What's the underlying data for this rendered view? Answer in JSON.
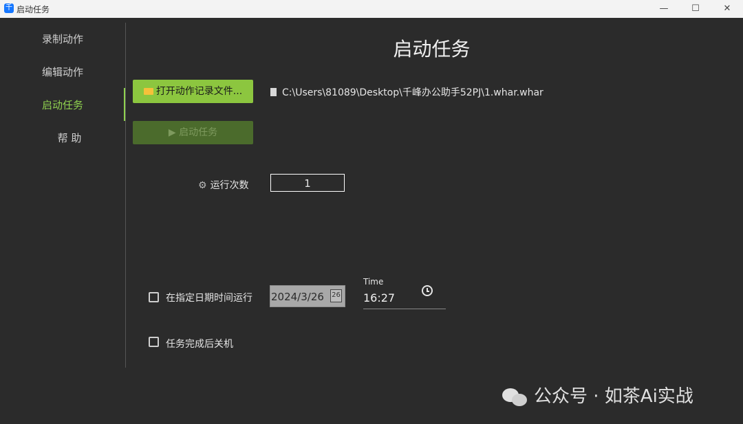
{
  "window": {
    "title": "启动任务",
    "icon": "app-logo-icon"
  },
  "window_controls": {
    "minimize": "—",
    "maximize": "☐",
    "close": "✕"
  },
  "sidebar": {
    "items": [
      {
        "label": "录制动作",
        "active": false
      },
      {
        "label": "编辑动作",
        "active": false
      },
      {
        "label": "启动任务",
        "active": true
      },
      {
        "label": "帮 助",
        "active": false
      }
    ],
    "active_color": "#8fd14f"
  },
  "main": {
    "title": "启动任务",
    "open_button_label": "打开动作记录文件...",
    "file_path": "C:\\Users\\81089\\Desktop\\千峰办公助手52PJ\\1.whar.whar",
    "start_button_label": "▶ 启动任务",
    "run_count_label": "运行次数",
    "run_count_value": "1",
    "schedule_checkbox_label": "在指定日期时间运行",
    "schedule_checked": false,
    "date_value": "2024/3/26",
    "calendar_icon_day": "26",
    "time_caption": "Time",
    "time_value": "16:27",
    "shutdown_checkbox_label": "任务完成后关机",
    "shutdown_checked": false
  },
  "watermark": {
    "text": "公众号 · 如茶Ai实战",
    "icon": "wechat-icon"
  },
  "colors": {
    "background": "#2b2b2b",
    "accent": "#8cc63f",
    "disabled_button": "#4b6b2c"
  }
}
